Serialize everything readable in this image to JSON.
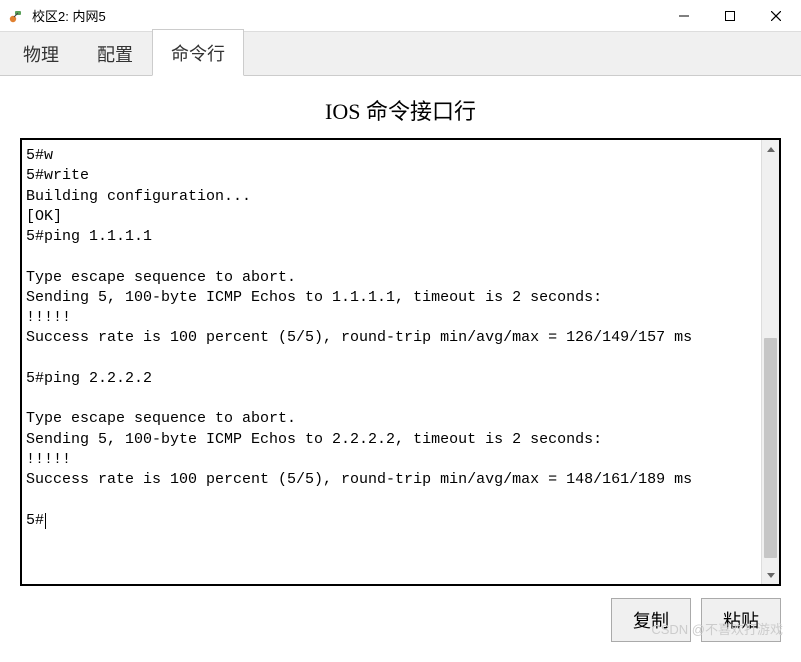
{
  "window": {
    "title": "校区2: 内网5"
  },
  "tabs": [
    {
      "label": "物理",
      "active": false
    },
    {
      "label": "配置",
      "active": false
    },
    {
      "label": "命令行",
      "active": true
    }
  ],
  "heading": "IOS 命令接口行",
  "terminal": {
    "lines": [
      "5#w",
      "5#write",
      "Building configuration...",
      "[OK]",
      "5#ping 1.1.1.1",
      "",
      "Type escape sequence to abort.",
      "Sending 5, 100-byte ICMP Echos to 1.1.1.1, timeout is 2 seconds:",
      "!!!!!",
      "Success rate is 100 percent (5/5), round-trip min/avg/max = 126/149/157 ms",
      "",
      "5#ping 2.2.2.2",
      "",
      "Type escape sequence to abort.",
      "Sending 5, 100-byte ICMP Echos to 2.2.2.2, timeout is 2 seconds:",
      "!!!!!",
      "Success rate is 100 percent (5/5), round-trip min/avg/max = 148/161/189 ms",
      "",
      "5#"
    ]
  },
  "buttons": {
    "copy": "复制",
    "paste": "粘贴"
  },
  "watermark": "CSDN @不喜欢打游戏"
}
